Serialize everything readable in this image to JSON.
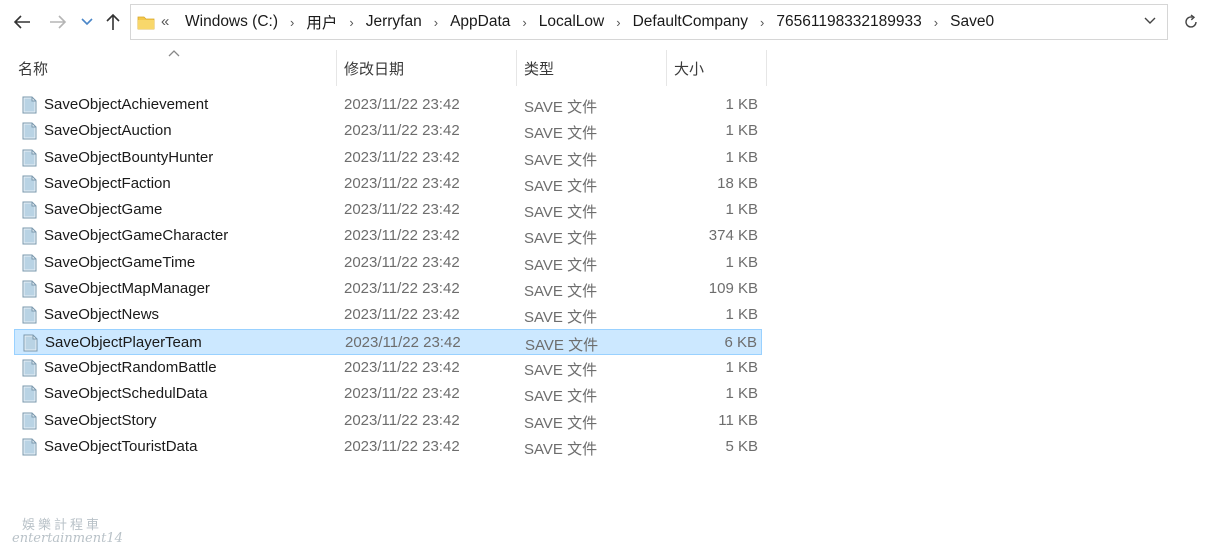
{
  "address_bar": {
    "overflow": "«",
    "crumbs": [
      "Windows (C:)",
      "用户",
      "Jerryfan",
      "AppData",
      "LocalLow",
      "DefaultCompany",
      "76561198332189933",
      "Save0"
    ]
  },
  "columns": {
    "name": "名称",
    "date": "修改日期",
    "type": "类型",
    "size": "大小"
  },
  "files": [
    {
      "name": "SaveObjectAchievement",
      "date": "2023/11/22 23:42",
      "type": "SAVE 文件",
      "size": "1 KB"
    },
    {
      "name": "SaveObjectAuction",
      "date": "2023/11/22 23:42",
      "type": "SAVE 文件",
      "size": "1 KB"
    },
    {
      "name": "SaveObjectBountyHunter",
      "date": "2023/11/22 23:42",
      "type": "SAVE 文件",
      "size": "1 KB"
    },
    {
      "name": "SaveObjectFaction",
      "date": "2023/11/22 23:42",
      "type": "SAVE 文件",
      "size": "18 KB"
    },
    {
      "name": "SaveObjectGame",
      "date": "2023/11/22 23:42",
      "type": "SAVE 文件",
      "size": "1 KB"
    },
    {
      "name": "SaveObjectGameCharacter",
      "date": "2023/11/22 23:42",
      "type": "SAVE 文件",
      "size": "374 KB"
    },
    {
      "name": "SaveObjectGameTime",
      "date": "2023/11/22 23:42",
      "type": "SAVE 文件",
      "size": "1 KB"
    },
    {
      "name": "SaveObjectMapManager",
      "date": "2023/11/22 23:42",
      "type": "SAVE 文件",
      "size": "109 KB"
    },
    {
      "name": "SaveObjectNews",
      "date": "2023/11/22 23:42",
      "type": "SAVE 文件",
      "size": "1 KB"
    },
    {
      "name": "SaveObjectPlayerTeam",
      "date": "2023/11/22 23:42",
      "type": "SAVE 文件",
      "size": "6 KB",
      "selected": true
    },
    {
      "name": "SaveObjectRandomBattle",
      "date": "2023/11/22 23:42",
      "type": "SAVE 文件",
      "size": "1 KB"
    },
    {
      "name": "SaveObjectSchedulData",
      "date": "2023/11/22 23:42",
      "type": "SAVE 文件",
      "size": "1 KB"
    },
    {
      "name": "SaveObjectStory",
      "date": "2023/11/22 23:42",
      "type": "SAVE 文件",
      "size": "11 KB"
    },
    {
      "name": "SaveObjectTouristData",
      "date": "2023/11/22 23:42",
      "type": "SAVE 文件",
      "size": "5 KB"
    }
  ],
  "watermark": {
    "line1": "娛樂計程車",
    "line2": "entertainment14"
  },
  "colors": {
    "selected_bg": "#cce8ff",
    "selected_border": "#99d1ff",
    "folder": "#f4c84a"
  }
}
